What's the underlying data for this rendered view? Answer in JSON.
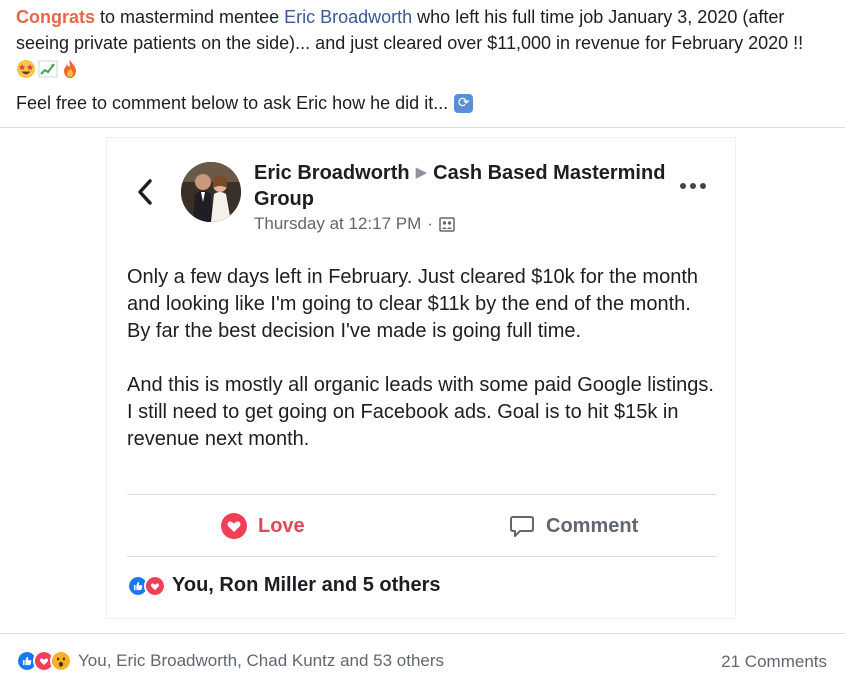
{
  "caption": {
    "congrats": "Congrats",
    "text_a": " to mastermind mentee ",
    "mention": "Eric Broadworth",
    "text_b": " who left his full time job January 3, 2020 (after seeing private patients on the side)... and just cleared over $11,000 in revenue for February 2020 !!",
    "emojis": [
      "star-struck-emoji",
      "chart-increasing-emoji",
      "fire-emoji"
    ],
    "line2": "Feel free to comment below to ask Eric how he did it..."
  },
  "post": {
    "author": "Eric Broadworth",
    "group": "Cash Based Mastermind Group",
    "timestamp": "Thursday at 12:17 PM",
    "separator": "·",
    "paragraph1": "Only a few days left in February. Just cleared $10k for the month and looking like I'm going to clear $11k by the end of the month. By far the best decision I've made is going full time.",
    "paragraph2": "And this is mostly all organic leads with some paid Google listings. I still need to get going on Facebook ads. Goal is to hit $15k in revenue next month.",
    "love_label": "Love",
    "comment_label": "Comment",
    "reactions_text": "You, Ron Miller and 5 others"
  },
  "footer": {
    "reactions_text": "You, Eric Broadworth, Chad Kuntz and 53 others",
    "comments_text": "21 Comments"
  },
  "colors": {
    "congrats": "#e66648",
    "mention": "#385898",
    "love": "#e0475b",
    "like_blue": "#1877f2",
    "love_red": "#f33e58",
    "wow_yellow": "#f7b125"
  }
}
